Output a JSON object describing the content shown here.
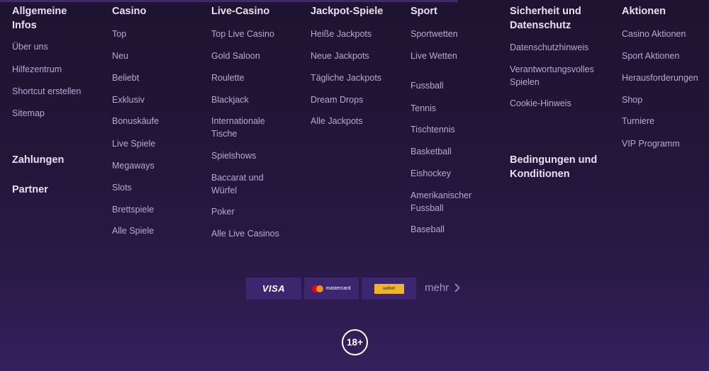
{
  "columns": [
    {
      "heading": "Allgemeine Infos",
      "heading_lines": [
        "Allgemeine",
        "Infos"
      ],
      "links": [
        "Über uns",
        "Hilfezentrum",
        "Shortcut erstellen",
        "Sitemap"
      ],
      "extra_headings": [
        "Zahlungen",
        "Partner"
      ]
    },
    {
      "heading": "Casino",
      "links": [
        "Top",
        "Neu",
        "Beliebt",
        "Exklusiv",
        "Bonuskäufe",
        "Live Spiele",
        "Megaways",
        "Slots",
        "Brettspiele",
        "Alle Spiele"
      ]
    },
    {
      "heading": "Live-Casino",
      "links": [
        "Top Live Casino",
        "Gold Saloon",
        "Roulette",
        "Blackjack",
        "Internationale Tische",
        "Spielshows",
        "Baccarat und Würfel",
        "Poker",
        "Alle Live Casinos"
      ],
      "link_lines": {
        "4": [
          "Internationale",
          "Tische"
        ],
        "6": [
          "Baccarat und",
          "Würfel"
        ]
      }
    },
    {
      "heading": "Jackpot-Spiele",
      "links": [
        "Heiße Jackpots",
        "Neue Jackpots",
        "Tägliche Jackpots",
        "Dream Drops",
        "Alle Jackpots"
      ]
    },
    {
      "heading": "Sport",
      "links": [
        "Sportwetten",
        "Live Wetten",
        "Fussball",
        "Tennis",
        "Tischtennis",
        "Basketball",
        "Eishockey",
        "Amerikanischer Fussball",
        "Baseball"
      ],
      "link_lines": {
        "7": [
          "Amerikanischer",
          "Fussball"
        ]
      }
    },
    {
      "heading": "Sicherheit und Datenschutz",
      "heading_lines": [
        "Sicherheit und",
        "Datenschutz"
      ],
      "links": [
        "Datenschutzhinweis",
        "Verantwortungsvolles Spielen",
        "Cookie-Hinweis"
      ],
      "link_lines": {
        "1": [
          "Verantwortungsvolles",
          "Spielen"
        ]
      },
      "extra_heading": "Bedingungen und Konditionen",
      "extra_heading_lines": [
        "Bedingungen und",
        "Konditionen"
      ]
    },
    {
      "heading": "Aktionen",
      "links": [
        "Casino Aktionen",
        "Sport Aktionen",
        "Herausforderungen",
        "Shop",
        "Turniere",
        "VIP Programm"
      ]
    }
  ],
  "payments": {
    "methods": [
      "VISA",
      "mastercard",
      "sofort"
    ],
    "more_label": "mehr"
  },
  "age_badge": "18+",
  "colors": {
    "heading": "#e6e0f0",
    "link": "#b8a9d4",
    "payment_bg": "#3c2670",
    "more": "#a58fd6"
  },
  "icons": [
    "chevron-right-icon",
    "visa-logo",
    "mastercard-logo",
    "sofort-logo",
    "age-18-icon"
  ]
}
